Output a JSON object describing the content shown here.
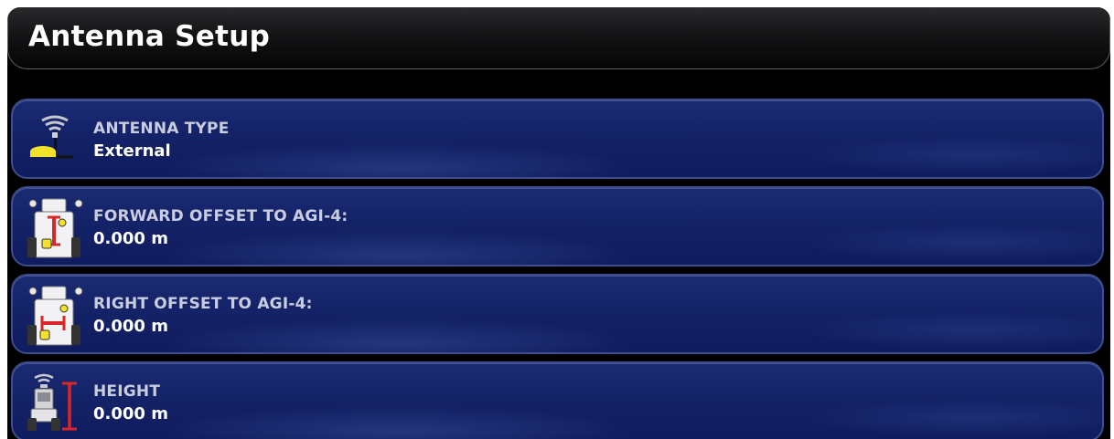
{
  "header": {
    "title": "Antenna Setup"
  },
  "rows": [
    {
      "label": "ANTENNA TYPE",
      "value": "External",
      "icon": "antenna-icon"
    },
    {
      "label": "FORWARD OFFSET TO AGI-4:",
      "value": "0.000 m",
      "icon": "forward-offset-icon"
    },
    {
      "label": "RIGHT OFFSET TO AGI-4:",
      "value": "0.000 m",
      "icon": "right-offset-icon"
    },
    {
      "label": "HEIGHT",
      "value": "0.000 m",
      "icon": "height-icon"
    }
  ],
  "colors": {
    "row_background": "#142267",
    "row_border": "#3d4d8e",
    "label": "#c9cde0",
    "value": "#ffffff",
    "accent_yellow": "#f2e22a",
    "accent_red": "#d8262b"
  }
}
